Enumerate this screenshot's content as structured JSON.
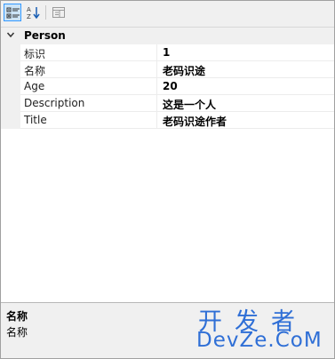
{
  "toolbar": {
    "buttons": [
      {
        "name": "categorized-view-icon",
        "active": true
      },
      {
        "name": "alphabetical-sort-icon",
        "active": false
      },
      {
        "name": "property-pages-icon",
        "active": false
      }
    ]
  },
  "grid": {
    "category": "Person",
    "rows": [
      {
        "name": "标识",
        "value": "1"
      },
      {
        "name": "名称",
        "value": "老码识途"
      },
      {
        "name": "Age",
        "value": "20"
      },
      {
        "name": "Description",
        "value": "这是一个人"
      },
      {
        "name": "Title",
        "value": "老码识途作者"
      }
    ]
  },
  "description": {
    "title": "名称",
    "text": "名称"
  },
  "watermark": {
    "cn": "开发者",
    "en": "DevZe.CoM"
  }
}
